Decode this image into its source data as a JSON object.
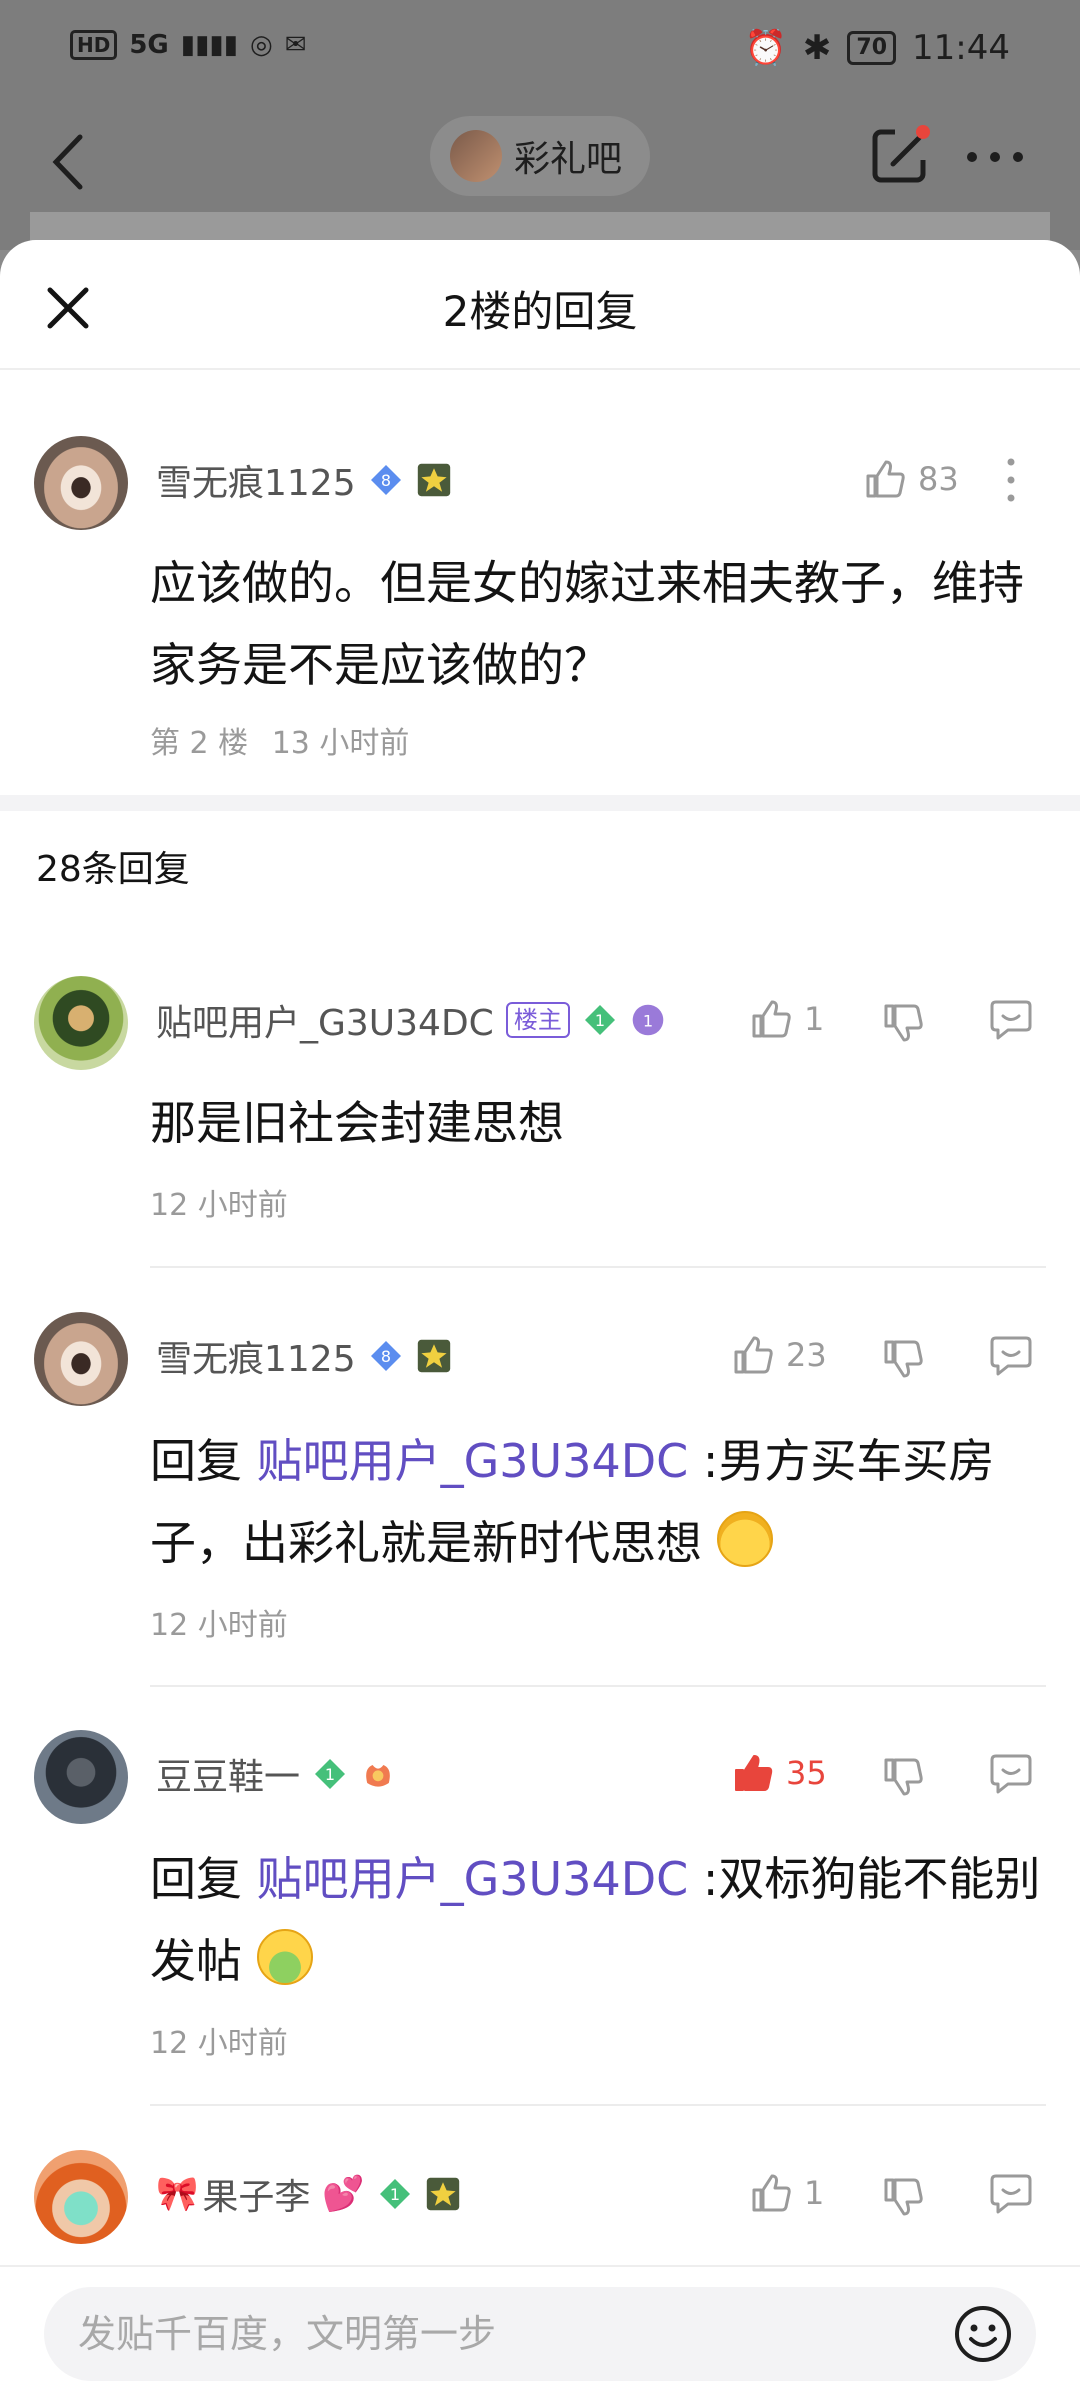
{
  "status_bar": {
    "network": "HD",
    "signal": "5G",
    "battery": "70",
    "time": "11:44"
  },
  "top_nav": {
    "forum_name": "彩礼吧"
  },
  "sheet": {
    "title": "2楼的回复"
  },
  "main_post": {
    "author": "雪无痕1125",
    "level": "8",
    "likes": "83",
    "content": "应该做的。但是女的嫁过来相夫教子，维持家务是不是应该做的？",
    "floor": "第 2 楼",
    "time": "13 小时前"
  },
  "reply_count_label": "28条回复",
  "replies": [
    {
      "author": "贴吧用户_G3U34DC",
      "op_badge": "楼主",
      "level": "1",
      "likes": "1",
      "content": "那是旧社会封建思想",
      "time": "12 小时前"
    },
    {
      "author": "雪无痕1125",
      "level": "8",
      "likes": "23",
      "reply_prefix": "回复",
      "reply_to": "贴吧用户_G3U34DC",
      "content": ":男方买车买房子，出彩礼就是新时代思想",
      "time": "12 小时前"
    },
    {
      "author": "豆豆鞋一",
      "level": "1",
      "likes": "35",
      "reply_prefix": "回复",
      "reply_to": "贴吧用户_G3U34DC",
      "content": ":双标狗能不能别发帖",
      "time": "12 小时前"
    },
    {
      "author": "果子李",
      "level": "1",
      "likes": "1"
    }
  ],
  "bottom_bar": {
    "input_placeholder": "发贴千百度，文明第一步"
  },
  "colors": {
    "link": "#614ec2",
    "liked_red": "#e8453c",
    "muted": "#9a9a9a",
    "op_badge": "#7a5cd9"
  }
}
